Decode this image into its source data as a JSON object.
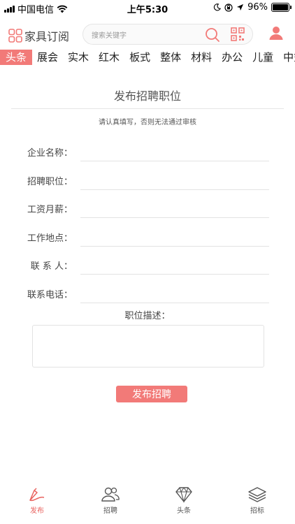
{
  "status_bar": {
    "carrier": "中国电信",
    "time": "上午5:30",
    "battery": "96%"
  },
  "header": {
    "app_name": "家具订阅",
    "search_placeholder": "搜索关键字"
  },
  "tabs": [
    "头条",
    "展会",
    "实木",
    "红木",
    "板式",
    "整体",
    "材料",
    "办公",
    "儿童",
    "中式"
  ],
  "active_tab": 0,
  "form": {
    "title": "发布招聘职位",
    "hint": "请认真填写，否则无法通过审核",
    "fields": [
      {
        "label": "企业名称：",
        "value": ""
      },
      {
        "label": "招聘职位：",
        "value": ""
      },
      {
        "label": "工资月薪：",
        "value": ""
      },
      {
        "label": "工作地点：",
        "value": ""
      },
      {
        "label": "联 系 人：",
        "value": ""
      },
      {
        "label": "联系电话：",
        "value": ""
      }
    ],
    "description_label": "职位描述：",
    "description_value": "",
    "submit_label": "发布招聘"
  },
  "bottom_nav": [
    {
      "label": "发布",
      "icon": "pen-icon",
      "active": true
    },
    {
      "label": "招聘",
      "icon": "people-icon",
      "active": false
    },
    {
      "label": "头条",
      "icon": "diamond-icon",
      "active": false
    },
    {
      "label": "招标",
      "icon": "layers-icon",
      "active": false
    }
  ],
  "colors": {
    "accent": "#f27a78",
    "active_nav": "#e9635f"
  }
}
